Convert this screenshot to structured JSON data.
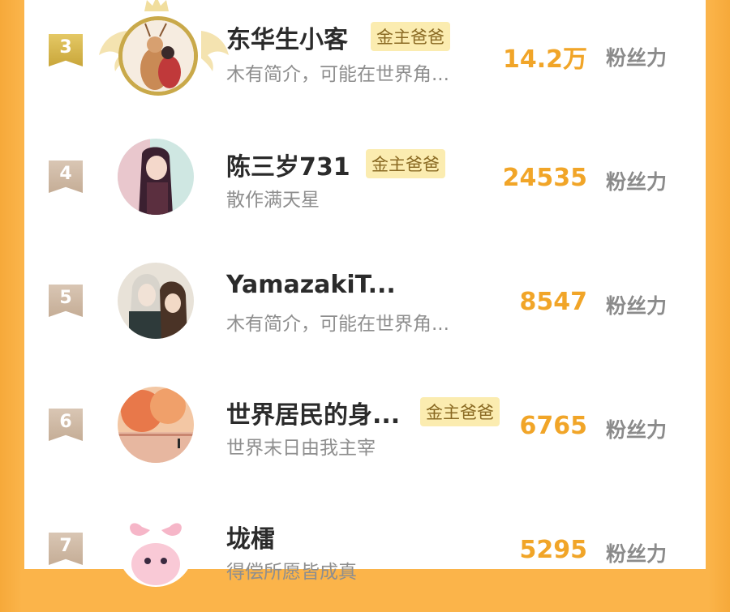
{
  "accent_color": "#f1a528",
  "badge_color": "#fbecb0",
  "rows": [
    {
      "rank": "3",
      "name": "东华生小客",
      "badge": "金主爸爸",
      "bio": "木有简介，可能在世界角...",
      "count": "14.2万",
      "unit": "粉丝力"
    },
    {
      "rank": "4",
      "name": "陈三岁731",
      "badge": "金主爸爸",
      "bio": "散作满天星",
      "count": "24535",
      "unit": "粉丝力"
    },
    {
      "rank": "5",
      "name": "YamazakiT...",
      "badge": "",
      "bio": "木有简介，可能在世界角...",
      "count": "8547",
      "unit": "粉丝力"
    },
    {
      "rank": "6",
      "name": "世界居民的身...",
      "badge": "金主爸爸",
      "bio": "世界末日由我主宰",
      "count": "6765",
      "unit": "粉丝力"
    },
    {
      "rank": "7",
      "name": "垅檑",
      "badge": "",
      "bio": "得偿所愿皆成真",
      "count": "5295",
      "unit": "粉丝力"
    }
  ]
}
